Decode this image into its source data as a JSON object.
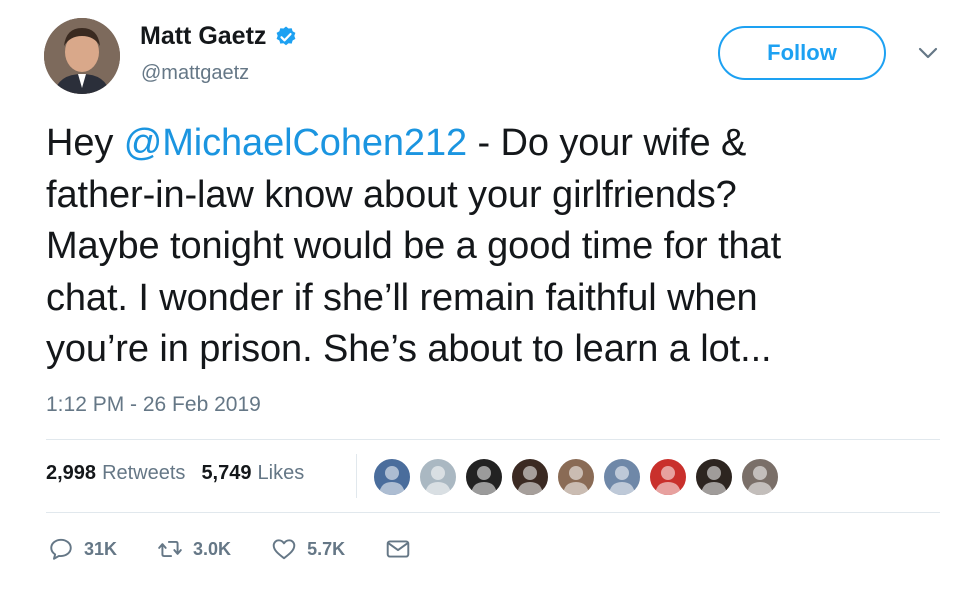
{
  "user": {
    "name": "Matt Gaetz",
    "handle": "@mattgaetz",
    "verified": true,
    "avatar_icon": "profile-photo"
  },
  "follow": {
    "label": "Follow"
  },
  "tweet": {
    "lines": [
      [
        "Hey ",
        "@MichaelCohen212",
        " - Do your wife &"
      ],
      "father-in-law know about your girlfriends?",
      "Maybe tonight would be a good time for that",
      "chat. I wonder if she’ll remain faithful when",
      "you’re in prison.  She’s about to learn a lot..."
    ],
    "timestamp": "1:12 PM - 26 Feb 2019"
  },
  "stats": {
    "retweets": {
      "count": "2,998",
      "label": "Retweets"
    },
    "likes": {
      "count": "5,749",
      "label": "Likes"
    }
  },
  "actions": {
    "reply": {
      "count": "31K",
      "icon": "reply-icon"
    },
    "retweet": {
      "count": "3.0K",
      "icon": "retweet-icon"
    },
    "like": {
      "count": "5.7K",
      "icon": "heart-icon"
    },
    "dm": {
      "icon": "envelope-icon"
    }
  },
  "colors": {
    "accent": "#1da1f2",
    "mention": "#1b95e0",
    "secondary_text": "#657786",
    "divider": "#e1e8ed"
  },
  "liker_faces": [
    {
      "bg": "#4a6d9c"
    },
    {
      "bg": "#aab8c2"
    },
    {
      "bg": "#222222"
    },
    {
      "bg": "#3b2a22"
    },
    {
      "bg": "#8a6b55"
    },
    {
      "bg": "#6f88a8"
    },
    {
      "bg": "#c9302c"
    },
    {
      "bg": "#2d2520"
    },
    {
      "bg": "#7a6f68"
    }
  ]
}
